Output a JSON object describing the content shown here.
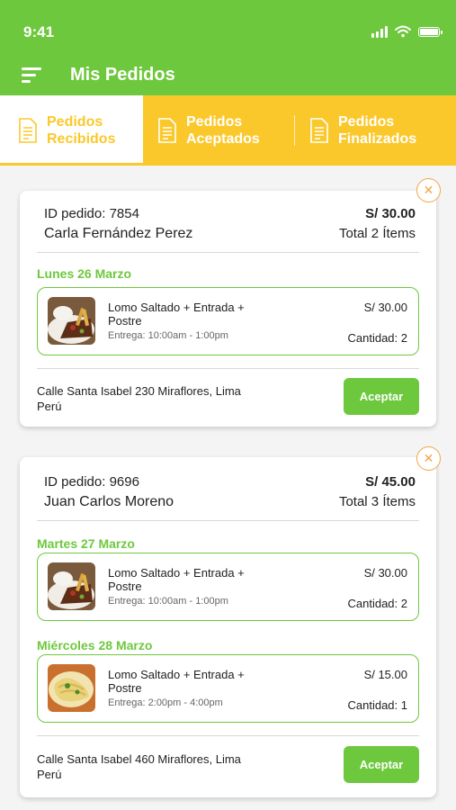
{
  "status_bar": {
    "time": "9:41"
  },
  "header": {
    "title": "Mis Pedidos"
  },
  "tabs": [
    {
      "label": "Pedidos Recibidos",
      "active": true
    },
    {
      "label": "Pedidos Aceptados",
      "active": false
    },
    {
      "label": "Pedidos Finalizados",
      "active": false
    }
  ],
  "orders": [
    {
      "id_label": "ID pedido:",
      "id": "7854",
      "customer": "Carla Fernández Perez",
      "total_price": "S/ 30.00",
      "total_items": "Total 2 Ítems",
      "groups": [
        {
          "date": "Lunes 26 Marzo",
          "item": {
            "name": "Lomo Saltado + Entrada + Postre",
            "delivery": "Entrega: 10:00am - 1:00pm",
            "price": "S/ 30.00",
            "quantity": "Cantidad: 2",
            "image": "lomo-saltado-photo"
          }
        }
      ],
      "address": "Calle Santa Isabel 230 Miraflores, Lima Perú",
      "accept_label": "Aceptar"
    },
    {
      "id_label": "ID pedido:",
      "id": "9696",
      "customer": "Juan Carlos Moreno",
      "total_price": "S/ 45.00",
      "total_items": "Total 3 Ítems",
      "groups": [
        {
          "date": "Martes 27 Marzo",
          "item": {
            "name": "Lomo Saltado + Entrada + Postre",
            "delivery": "Entrega: 10:00am - 1:00pm",
            "price": "S/ 30.00",
            "quantity": "Cantidad: 2",
            "image": "lomo-saltado-photo"
          }
        },
        {
          "date": "Miércoles 28 Marzo",
          "item": {
            "name": "Lomo Saltado + Entrada + Postre",
            "delivery": "Entrega: 2:00pm - 4:00pm",
            "price": "S/ 15.00",
            "quantity": "Cantidad: 1",
            "image": "pasta-dish-photo"
          }
        }
      ],
      "address": "Calle Santa Isabel 460 Miraflores, Lima Perú",
      "accept_label": "Aceptar"
    }
  ],
  "colors": {
    "primary_green": "#6ec83d",
    "accent_yellow": "#fbc82c",
    "close_orange": "#f2a44a"
  },
  "icons": [
    "menu-icon",
    "document-icon",
    "close-icon",
    "signal-icon",
    "wifi-icon",
    "battery-icon"
  ]
}
